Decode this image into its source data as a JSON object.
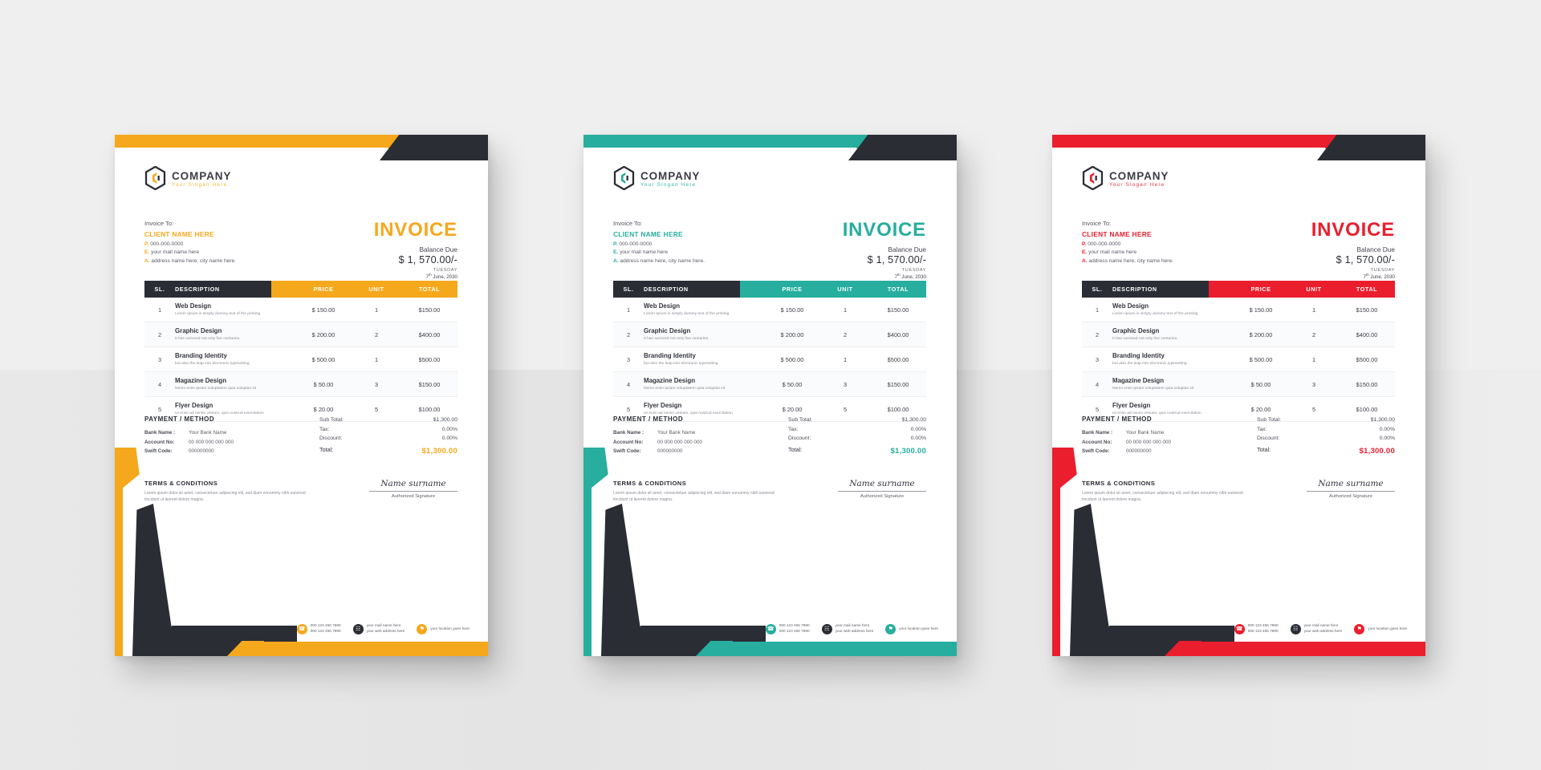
{
  "document": {
    "type": "invoice-template-mockup",
    "variant_count": 3
  },
  "brand": {
    "company_name": "COMPANY",
    "slogan": "Your Slogan Here",
    "logo_icon": "hexagon-logo-icon"
  },
  "bill_to": {
    "label": "Invoice To:",
    "client_name": "CLIENT NAME HERE",
    "phone_prefix": "P.",
    "phone": "000-000-0000",
    "email_prefix": "E.",
    "email": "your mail name here",
    "address_prefix": "A.",
    "address": "address name here, city name here."
  },
  "invoice_header": {
    "title": "INVOICE",
    "balance_label": "Balance Due",
    "balance_amount": "$ 1, 570.00/-",
    "day": "TUESDAY",
    "date": "7",
    "date_sup": "th",
    "date_rest": " June, 2030"
  },
  "table": {
    "columns": [
      "SL.",
      "DESCRIPTION",
      "PRICE",
      "UNIT",
      "TOTAL"
    ],
    "rows": [
      {
        "sl": "1",
        "name": "Web Design",
        "sub": "Lorem Ipsum is simply dummy text of the printing",
        "price": "$ 150.00",
        "unit": "1",
        "total": "$150.00"
      },
      {
        "sl": "2",
        "name": "Graphic Design",
        "sub": "It has survived not only five centuries.",
        "price": "$ 200.00",
        "unit": "2",
        "total": "$400.00"
      },
      {
        "sl": "3",
        "name": "Branding Identity",
        "sub": "but also the leap into electronic typesetting.",
        "price": "$ 500.00",
        "unit": "1",
        "total": "$500.00"
      },
      {
        "sl": "4",
        "name": "Magazine Design",
        "sub": "Nemo enim ipsam voluptatem quia voluptas sit",
        "price": "$ 50.00",
        "unit": "3",
        "total": "$150.00"
      },
      {
        "sl": "5",
        "name": "Flyer Design",
        "sub": "Ut enim ad minim veniam, quis nostrud exercitation",
        "price": "$ 20.00",
        "unit": "5",
        "total": "$100.00"
      }
    ]
  },
  "payment": {
    "title": "PAYMENT / METHOD",
    "rows": [
      {
        "key": "Bank Name :",
        "value": "Your Bank Name"
      },
      {
        "key": "Account No:",
        "value": "00 000 000 000 000"
      },
      {
        "key": "Swift Code:",
        "value": "000000000"
      }
    ]
  },
  "totals": {
    "rows": [
      {
        "key": "Sub Total:",
        "value": "$1,300.00"
      },
      {
        "key": "Tax:",
        "value": "0.00%"
      },
      {
        "key": "Discount:",
        "value": "0.00%"
      }
    ],
    "grand_key": "Total:",
    "grand_value": "$1,300.00"
  },
  "terms": {
    "title": "TERMS & CONDITIONS",
    "body": "Lorem ipsum dolor sit amet, consectetuer adipiscing elit, sed diam nonummy nibh euismod tincidunt ut laoreet dolore magna."
  },
  "signature": {
    "name": "Name surname",
    "label": "Authorized Signature"
  },
  "footer_contacts": [
    {
      "icon": "phone-icon",
      "line1": "000 123 456 7890",
      "line2": "000 123 456 7890"
    },
    {
      "icon": "globe-icon",
      "line1": "your mail name here",
      "line2": "your web address here"
    },
    {
      "icon": "location-pin-icon",
      "line1": "your location goes here",
      "line2": ""
    }
  ],
  "variants": [
    {
      "name": "yellow",
      "accent": "#f5a81c",
      "accent_soft": "#f6b731",
      "dark": "#2b2d35"
    },
    {
      "name": "teal",
      "accent": "#27ae9e",
      "accent_soft": "#2fb9a8",
      "dark": "#2b2d35"
    },
    {
      "name": "red",
      "accent": "#ea1e2d",
      "accent_soft": "#ef2a38",
      "dark": "#2b2d35"
    }
  ]
}
